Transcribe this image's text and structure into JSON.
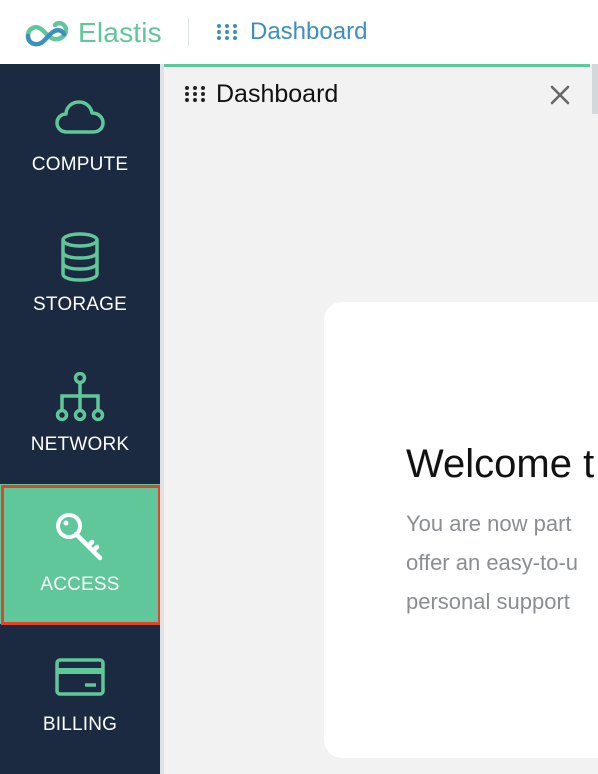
{
  "header": {
    "brand": "Elastis",
    "breadcrumb": "Dashboard"
  },
  "sidebar": {
    "items": [
      {
        "label": "COMPUTE",
        "icon": "cloud-icon"
      },
      {
        "label": "STORAGE",
        "icon": "database-icon"
      },
      {
        "label": "NETWORK",
        "icon": "network-icon"
      },
      {
        "label": "ACCESS",
        "icon": "key-icon",
        "active": true
      },
      {
        "label": "BILLING",
        "icon": "credit-card-icon"
      }
    ]
  },
  "tab": {
    "title": "Dashboard"
  },
  "welcome_card": {
    "heading": "Welcome t",
    "lines": [
      "You are now part",
      "offer an easy-to-u",
      "personal support"
    ]
  },
  "colors": {
    "sidebar_bg": "#1b2a40",
    "accent": "#5fc79a",
    "breadcrumb": "#3d8fc0",
    "highlight_border": "#e0452a",
    "main_bg": "#f2f2f2"
  }
}
